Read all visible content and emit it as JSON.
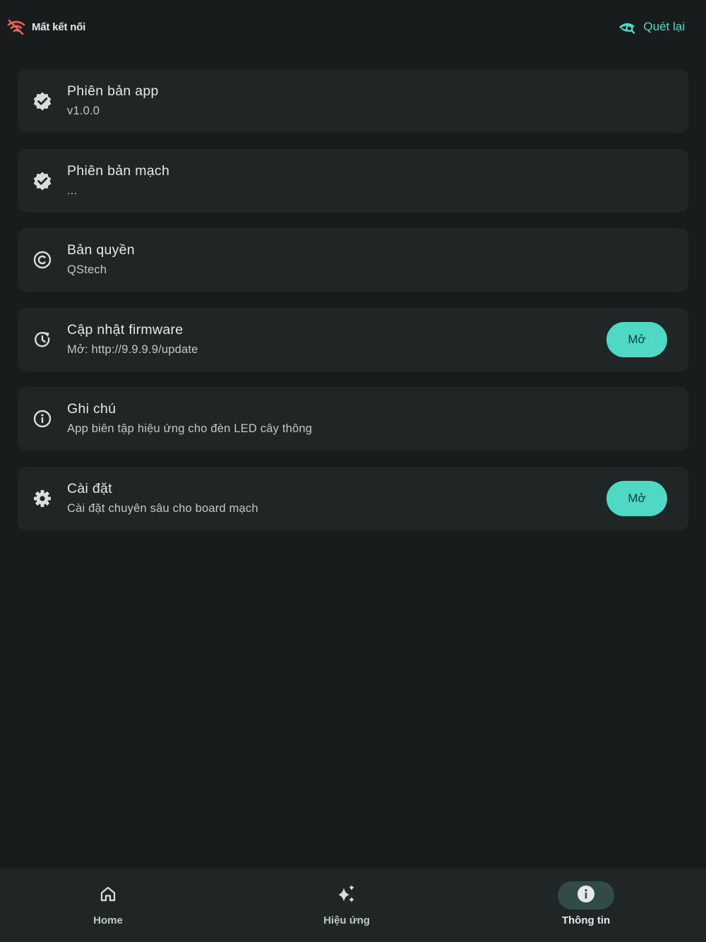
{
  "status": {
    "icon": "wifi-off-icon",
    "label": "Mất kết nối",
    "color": "#f0605a"
  },
  "rescan": {
    "icon": "eye-search-icon",
    "label": "Quét lại",
    "color": "#4fd8c4"
  },
  "cards": [
    {
      "icon": "verified-badge-icon",
      "title": "Phiên bản app",
      "subtitle": "v1.0.0"
    },
    {
      "icon": "verified-badge-icon",
      "title": "Phiên bản mạch",
      "subtitle": "..."
    },
    {
      "icon": "copyright-icon",
      "title": "Bản quyền",
      "subtitle": "QStech"
    },
    {
      "icon": "update-icon",
      "title": "Cập nhật firmware",
      "subtitle": "Mở: http://9.9.9.9/update",
      "button": "Mở"
    },
    {
      "icon": "info-outline-icon",
      "title": "Ghi chú",
      "subtitle": "App biên tập hiệu ứng cho đèn LED cây thông"
    },
    {
      "icon": "gear-icon",
      "title": "Cài đặt",
      "subtitle": "Cài đặt chuyên sâu cho board mạch",
      "button": "Mở"
    }
  ],
  "nav": {
    "items": [
      {
        "icon": "home-icon",
        "label": "Home",
        "active": false
      },
      {
        "icon": "sparkles-icon",
        "label": "Hiệu ứng",
        "active": false
      },
      {
        "icon": "info-filled-icon",
        "label": "Thông tin",
        "active": true
      }
    ]
  },
  "colors": {
    "background": "#191c1c",
    "card": "#1f2625",
    "accent": "#4fd8c4",
    "nav_active_pill": "#324b47"
  }
}
